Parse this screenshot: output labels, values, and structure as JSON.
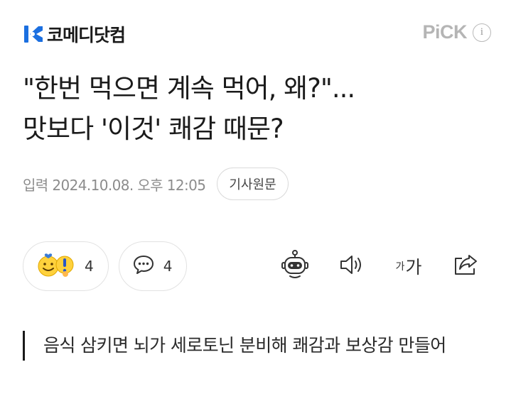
{
  "header": {
    "publisher": "코메디닷컴",
    "pick_label": "PiCK",
    "info_icon": "i"
  },
  "article": {
    "title_line1": "\"한번 먹으면 계속 먹어, 왜?\"...",
    "title_line2": "맛보다 '이것' 쾌감 때문?",
    "date": "입력 2024.10.08. 오후 12:05",
    "origin_button": "기사원문"
  },
  "reactions": {
    "emotion_count": "4",
    "comment_count": "4"
  },
  "tools": {
    "font_small": "가",
    "font_large": "가",
    "icons": [
      "robot-icon",
      "speaker-icon",
      "font-size-icon",
      "share-icon"
    ]
  },
  "summary": {
    "text": "음식 삼키면 뇌가 세로토닌 분비해 쾌감과 보상감 만들어"
  },
  "colors": {
    "logo_blue": "#1b6fe0",
    "pick_gray": "#b5b5b5",
    "emoji_yellow": "#ffd13c"
  }
}
